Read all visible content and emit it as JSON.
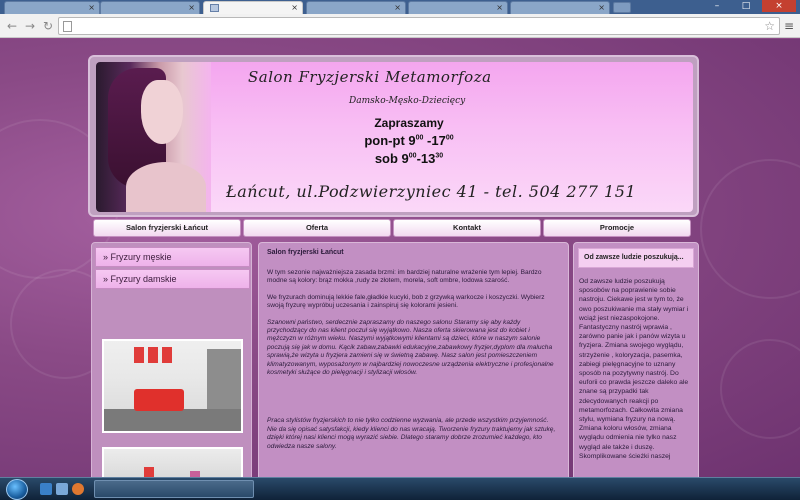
{
  "browser": {
    "tab_close_glyph": "×",
    "address": "",
    "nav": {
      "back": "←",
      "forward": "→",
      "reload": "↻"
    },
    "star_glyph": "☆",
    "menu_glyph": "≡"
  },
  "header": {
    "title": "Salon Fryzjerski Metamorfoza",
    "subtitle": "Damsko-Męsko-Dziecięcy",
    "invite_line": "Zapraszamy",
    "hours_weekday_prefix": "pon-pt 9",
    "hours_weekday_start_min": "00",
    "hours_weekday_mid": " -17",
    "hours_weekday_end_min": "00",
    "hours_sat_prefix": "sob 9",
    "hours_sat_start_min": "00",
    "hours_sat_mid": "-13",
    "hours_sat_end_min": "30",
    "address": "Łańcut, ul.Podzwierzyniec 41  - tel. 504 277 151"
  },
  "menu": {
    "items": [
      {
        "label": "Salon fryzjerski Łańcut"
      },
      {
        "label": "Oferta"
      },
      {
        "label": "Kontakt"
      },
      {
        "label": "Promocje"
      }
    ]
  },
  "sidebar": {
    "links": [
      {
        "label": "» Fryzury męskie"
      },
      {
        "label": "» Fryzury damskie"
      }
    ]
  },
  "content": {
    "heading": "Salon fryzjerski Łańcut",
    "p1": "W tym sezonie najważniejsza zasada brzmi: im bardziej naturalne wrażenie tym lepiej. Bardzo modne są kolory: brąz mokka ,rudy ze złotem, morela, soft ombre, lodowa szarość.",
    "p2": "We fryzurach dominują lekkie fale,gładkie kucyki, bob z grzywką warkocze i koszyczki. Wybierz swoją fryzurę wypróbuj uczesania i zainspiruj się kolorami jesieni.",
    "p3": "Szanowni państwo, serdecznie zapraszamy do naszego salonu Staramy się aby każdy przychodzący do nas klient poczuł się wyjątkowo. Nasza oferta skierowana jest do kobiet i mężczyzn w różnym wieku. Naszymi wyjątkowymi klientami są dzieci, które w naszym salonie poczują się jak w domu. Kącik zabaw,zabawki edukacyjne,zabawkowy fryzjer,dyplom dla malucha sprawią,że wizyta u fryzjera zamieni się w świetną zabawę. Nasz salon jest pomieszczeniem klimatyzowanym, wyposażonym w najbardziej nowoczesne urządzenia elektryczne i profesjonalne kosmetyki służące do pielęgnacji i stylizacji włosów.",
    "p4": "Praca stylistów fryzjerskich to nie tylko codzienne wyzwania, ale przede wszystkim przyjemność. Nie da się opisać satysfakcji, kiedy klienci do nas wracają. Tworzenie fryzury traktujemy jak sztukę, dzięki której nasi klienci mogą wyrazić siebie. Dlatego staramy dobrze zrozumieć każdego, kto odwiedza nasze salony."
  },
  "aside": {
    "heading": "Od zawsze ludzie poszukują...",
    "text": "Od zawsze ludzie poszukują sposobów na poprawienie sobie nastroju. Ciekawe jest w tym to, że owo poszukiwanie ma stały wymiar i wciąż jest niezaspokojone. Fantastyczny nastrój wprawia , zarówno panie jak i panów wizyta u fryzjera. Zmiana swojego wyglądu, strzyżenie , koloryzacja, pasemka, zabiegi pielęgnacyjne to uznany sposób na pozytywny nastrój. Do euforii co prawda jeszcze daleko ale znane są przypadki tak zdecydowanych reakcji po metamorfozach. Całkowita zmiana stylu, wymiana fryzury na nową. Zmiana koloru włosów, zmiana wyglądu odmienia nie tylko nasz wygląd ale także i duszę. Skomplikowane ścieżki naszej"
  },
  "colors": {
    "page_bg": "#8a4a86",
    "header_pink": "#f8bff4",
    "menu_bg": "#f2d9f0",
    "panel_bg": "#c28fc3"
  }
}
